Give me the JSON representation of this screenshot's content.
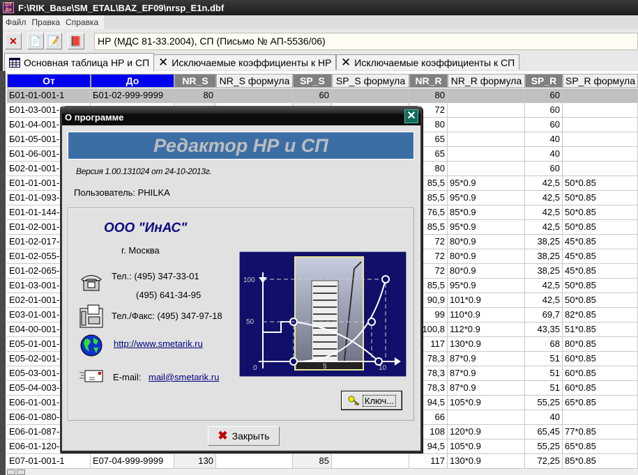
{
  "window": {
    "title": "F:\\RIK_Base\\SM_ETAL\\BAZ_EF09\\nrsp_E1n.dbf",
    "app_icon_text": "ОТ До"
  },
  "menu": [
    "Файл",
    "Правка",
    "Справка"
  ],
  "toolbar": {
    "info": "НР (МДС 81-33.2004), СП (Письмо № АП-5536/06)"
  },
  "tabs": [
    {
      "label": "Основная таблица НР и СП"
    },
    {
      "label": "Исключаемые коэффициенты к НР"
    },
    {
      "label": "Исключаемые коэффициенты к СП"
    }
  ],
  "columns": [
    "От",
    "До",
    "NR_S",
    "NR_S формула",
    "SP_S",
    "SP_S формула",
    "NR_R",
    "NR_R формула",
    "SP_R",
    "SP_R формула"
  ],
  "rows": [
    [
      "Б01-01-001-1",
      "Б01-02-999-9999",
      "80",
      "",
      "60",
      "",
      "80",
      "",
      "60",
      ""
    ],
    [
      "Б01-03-001-1",
      "",
      "",
      "",
      "",
      "",
      "72",
      "",
      "60",
      ""
    ],
    [
      "Б01-04-001-1",
      "",
      "",
      "",
      "",
      "",
      "80",
      "",
      "60",
      ""
    ],
    [
      "Б01-05-001-1",
      "",
      "",
      "",
      "",
      "",
      "65",
      "",
      "40",
      ""
    ],
    [
      "Б01-06-001-1",
      "",
      "",
      "",
      "",
      "",
      "65",
      "",
      "40",
      ""
    ],
    [
      "Б02-01-001-1",
      "",
      "",
      "",
      "",
      "",
      "80",
      "",
      "60",
      ""
    ],
    [
      "Е01-01-001-1",
      "",
      "",
      "",
      "",
      "",
      "85,5",
      "95*0.9",
      "42,5",
      "50*0.85"
    ],
    [
      "Е01-01-093-1",
      "",
      "",
      "",
      "",
      "",
      "85,5",
      "95*0.9",
      "42,5",
      "50*0.85"
    ],
    [
      "Е01-01-144-1",
      "",
      "",
      "",
      "",
      "",
      "76,5",
      "85*0.9",
      "42,5",
      "50*0.85"
    ],
    [
      "Е01-02-001-1",
      "",
      "",
      "",
      "",
      "",
      "85,5",
      "95*0.9",
      "42,5",
      "50*0.85"
    ],
    [
      "Е01-02-017-1",
      "",
      "",
      "",
      "",
      "",
      "72",
      "80*0.9",
      "38,25",
      "45*0.85"
    ],
    [
      "Е01-02-055-1",
      "",
      "",
      "",
      "",
      "",
      "72",
      "80*0.9",
      "38,25",
      "45*0.85"
    ],
    [
      "Е01-02-065-1",
      "",
      "",
      "",
      "",
      "",
      "72",
      "80*0.9",
      "38,25",
      "45*0.85"
    ],
    [
      "Е01-03-001-1",
      "",
      "",
      "",
      "",
      "",
      "85,5",
      "95*0.9",
      "42,5",
      "50*0.85"
    ],
    [
      "Е02-01-001-1",
      "",
      "",
      "",
      "",
      "",
      "90,9",
      "101*0.9",
      "42,5",
      "50*0.85"
    ],
    [
      "Е03-01-001-1",
      "",
      "",
      "",
      "",
      "",
      "99",
      "110*0.9",
      "69,7",
      "82*0.85"
    ],
    [
      "Е04-00-001-1",
      "",
      "",
      "",
      "",
      "",
      "100,8",
      "112*0.9",
      "43,35",
      "51*0.85"
    ],
    [
      "Е05-01-001-1",
      "",
      "",
      "",
      "",
      "",
      "117",
      "130*0.9",
      "68",
      "80*0.85"
    ],
    [
      "Е05-02-001-1",
      "",
      "",
      "",
      "",
      "",
      "78,3",
      "87*0.9",
      "51",
      "60*0.85"
    ],
    [
      "Е05-03-001-1",
      "",
      "",
      "",
      "",
      "",
      "78,3",
      "87*0.9",
      "51",
      "60*0.85"
    ],
    [
      "Е05-04-003-1",
      "",
      "",
      "",
      "",
      "",
      "78,3",
      "87*0.9",
      "51",
      "60*0.85"
    ],
    [
      "Е06-01-001-1",
      "",
      "",
      "",
      "",
      "",
      "94,5",
      "105*0.9",
      "55,25",
      "65*0.85"
    ],
    [
      "Е06-01-080-1",
      "",
      "",
      "",
      "",
      "",
      "66",
      "",
      "40",
      ""
    ],
    [
      "Е06-01-087-1",
      "",
      "",
      "",
      "",
      "",
      "108",
      "120*0.9",
      "65,45",
      "77*0.85"
    ],
    [
      "Е06-01-120-1",
      "",
      "",
      "",
      "",
      "",
      "94,5",
      "105*0.9",
      "55,25",
      "65*0.85"
    ],
    [
      "Е07-01-001-1",
      "Е07-04-999-9999",
      "130",
      "",
      "85",
      "",
      "117",
      "130*0.9",
      "72,25",
      "85*0.85"
    ]
  ],
  "dialog": {
    "title": "О программе",
    "close_glyph": "✕",
    "banner": "Редактор НР и СП",
    "version": "Версия 1.00.131024  от 24-10-2013г.",
    "user": "Пользователь: PHILKA",
    "company": "ООО \"ИнАС\"",
    "city": "г. Москва",
    "phone_label": "Тел.: (495) 347-33-01",
    "phone2": "(495) 641-34-95",
    "fax": "Тел./Факс: (495) 347-97-18",
    "website": "http://www.smetarik.ru",
    "email_label": "E-mail:",
    "email": "mail@smetarik.ru",
    "picture_labels": {
      "y100": "100",
      "y50": "50",
      "y0": "0",
      "x5": "5",
      "x10": "10"
    },
    "key_button": "Ключ...",
    "close_button": "Закрыть"
  },
  "colors": {
    "header_blue": "#0000f0",
    "header_gray": "#808080",
    "banner": "#3b6ea5",
    "company": "#0a0a80"
  }
}
